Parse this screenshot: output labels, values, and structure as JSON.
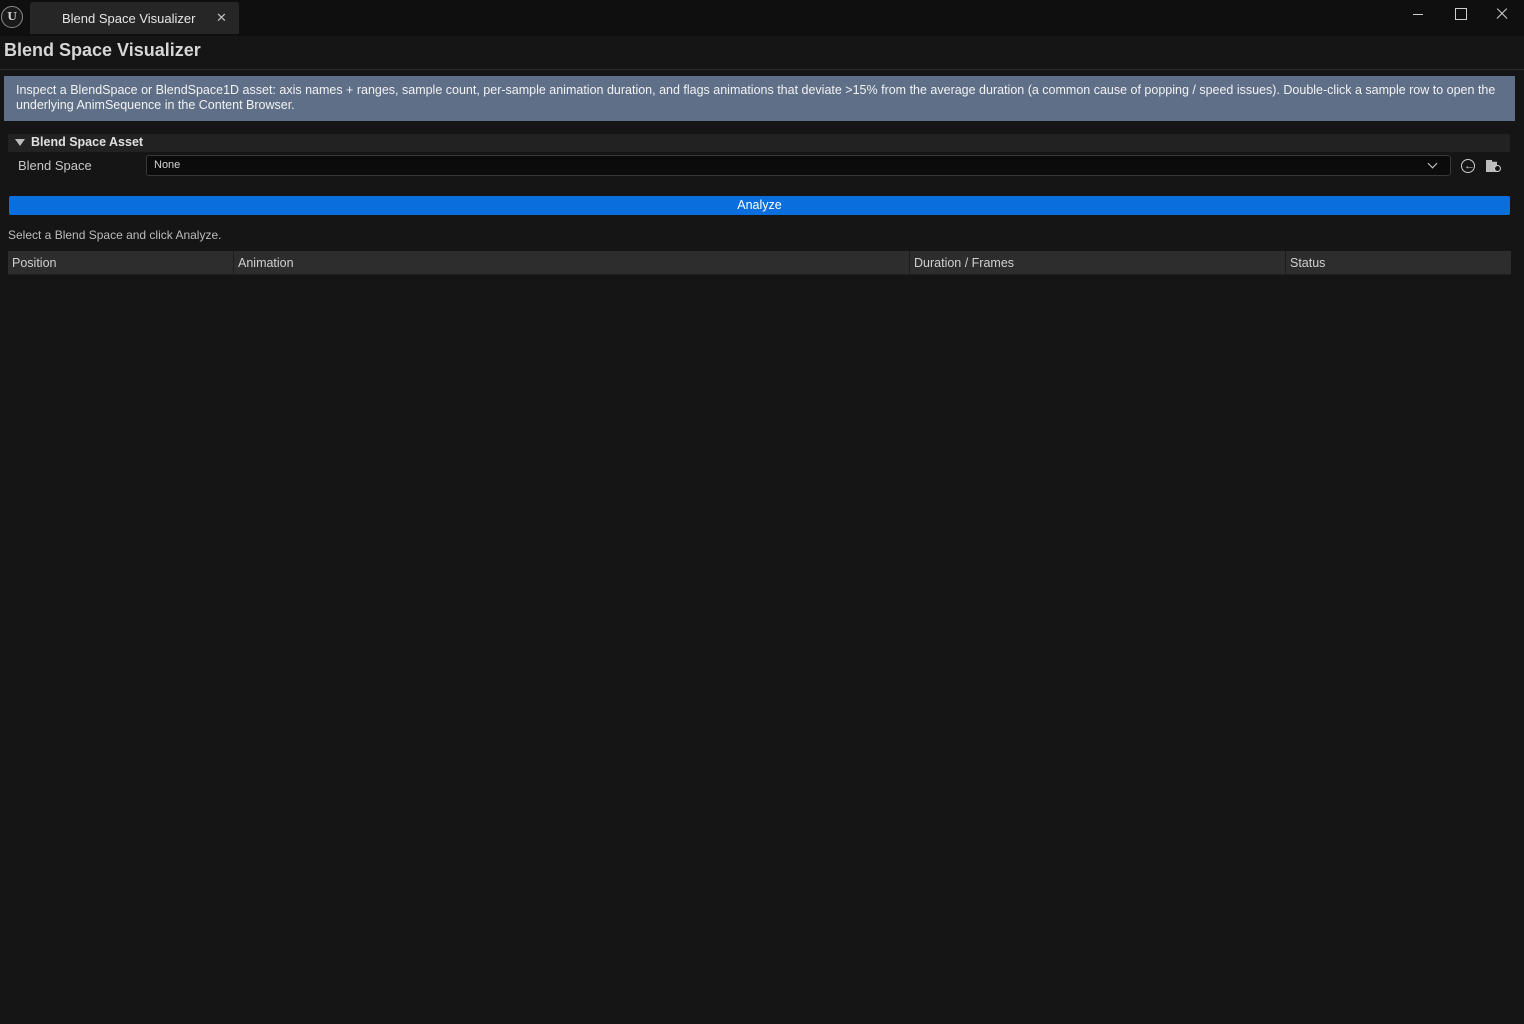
{
  "window": {
    "tab_title": "Blend Space Visualizer",
    "tab_close_icon": "close-icon",
    "logo_glyph": "U"
  },
  "page": {
    "title": "Blend Space Visualizer",
    "description": "Inspect a BlendSpace or BlendSpace1D asset: axis names + ranges, sample count, per-sample animation duration, and flags animations that deviate >15% from the average duration (a common cause of popping / speed issues). Double-click a sample row to open the underlying AnimSequence in the Content Browser."
  },
  "section": {
    "title": "Blend Space Asset",
    "property_label": "Blend Space",
    "selected_value": "None"
  },
  "analyze_button": {
    "label": "Analyze"
  },
  "hint_text": "Select a Blend Space and click Analyze.",
  "table": {
    "columns": [
      "Position",
      "Animation",
      "Duration / Frames",
      "Status"
    ],
    "rows": []
  },
  "colors": {
    "background": "#151515",
    "info_box": "#5f6f88",
    "accent_button": "#0a6fdc"
  }
}
